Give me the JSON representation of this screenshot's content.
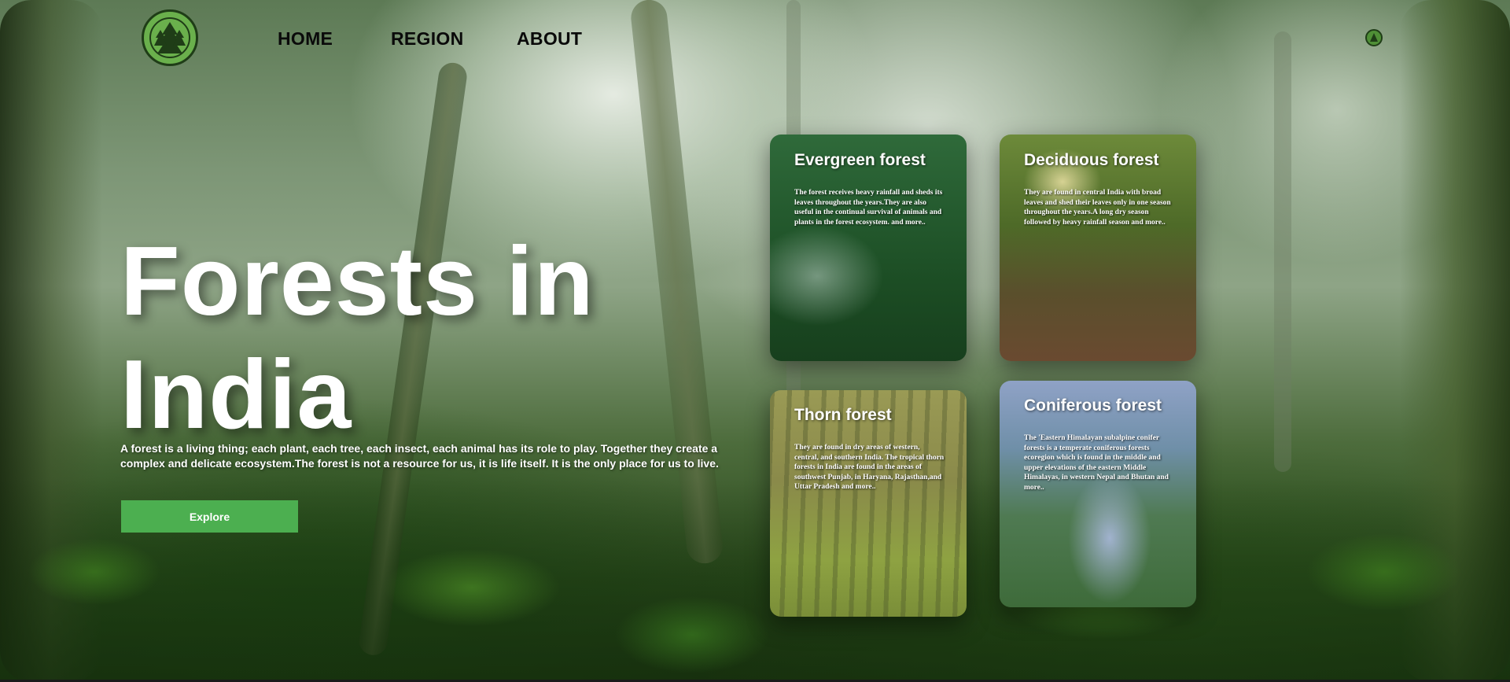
{
  "nav": {
    "links": [
      {
        "label": "HOME"
      },
      {
        "label": "REGION"
      },
      {
        "label": "ABOUT"
      }
    ],
    "logo_icon": "pine-trees-logo-icon",
    "secondary_icon": "pine-trees-mini-icon"
  },
  "hero": {
    "title": "Forests in India",
    "description": "A forest is a living thing; each plant, each tree, each insect, each animal has its role to play. Together they create a complex and delicate ecosystem.The forest is not a resource for us, it is life itself. It is the only place for us to live.",
    "button_label": "Explore"
  },
  "cards": [
    {
      "title": "Evergreen forest",
      "text": "The forest receives heavy rainfall and sheds its leaves throughout the years.They are also useful in the continual survival of animals and plants in the forest ecosystem. and more.."
    },
    {
      "title": "Deciduous forest",
      "text": "They are found in central India with broad leaves and shed their leaves only in one season throughout the years.A long dry season followed by heavy rainfall season and more.."
    },
    {
      "title": "Thorn forest",
      "text": "They are found in dry areas of western, central, and southern India. The tropical thorn forests in India are found in the areas of southwest Punjab, in Haryana, Rajasthan,and Uttar Pradesh and more.."
    },
    {
      "title": "Coniferous forest",
      "text": "The 'Eastern Himalayan subalpine conifer forests is a temperate coniferous forests ecoregion which is found in the middle and upper elevations of the eastern Middle Himalayas, in western Nepal and Bhutan and more.."
    }
  ],
  "colors": {
    "accent": "#4caf50",
    "logo_green": "#6ab04c",
    "nav_text": "#0a0a0a"
  }
}
